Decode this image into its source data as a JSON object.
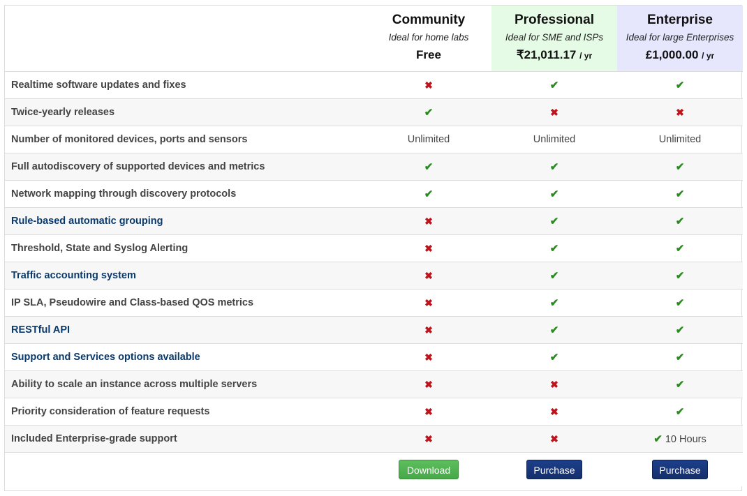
{
  "plans": [
    {
      "name": "Community",
      "description": "Ideal for home labs",
      "price": "Free",
      "unit": ""
    },
    {
      "name": "Professional",
      "description": "Ideal for SME and ISPs",
      "price": "₹21,011.17",
      "unit": "/ yr"
    },
    {
      "name": "Enterprise",
      "description": "Ideal for large Enterprises",
      "price": "£1,000.00",
      "unit": "/ yr"
    }
  ],
  "features": [
    {
      "label": "Realtime software updates and fixes",
      "link": false,
      "values": [
        "no",
        "yes",
        "yes"
      ]
    },
    {
      "label": "Twice-yearly releases",
      "link": false,
      "values": [
        "yes",
        "no",
        "no"
      ]
    },
    {
      "label": "Number of monitored devices, ports and sensors",
      "link": false,
      "values": [
        "Unlimited",
        "Unlimited",
        "Unlimited"
      ]
    },
    {
      "label": "Full autodiscovery of supported devices and metrics",
      "link": false,
      "values": [
        "yes",
        "yes",
        "yes"
      ]
    },
    {
      "label": "Network mapping through discovery protocols",
      "link": false,
      "values": [
        "yes",
        "yes",
        "yes"
      ]
    },
    {
      "label": "Rule-based automatic grouping",
      "link": true,
      "values": [
        "no",
        "yes",
        "yes"
      ]
    },
    {
      "label": "Threshold, State and Syslog Alerting",
      "link": false,
      "values": [
        "no",
        "yes",
        "yes"
      ]
    },
    {
      "label": "Traffic accounting system",
      "link": true,
      "values": [
        "no",
        "yes",
        "yes"
      ]
    },
    {
      "label": "IP SLA, Pseudowire and Class-based QOS metrics",
      "link": false,
      "values": [
        "no",
        "yes",
        "yes"
      ]
    },
    {
      "label": "RESTful API",
      "link": true,
      "values": [
        "no",
        "yes",
        "yes"
      ]
    },
    {
      "label": "Support and Services options available",
      "link": true,
      "values": [
        "no",
        "yes",
        "yes"
      ]
    },
    {
      "label": "Ability to scale an instance across multiple servers",
      "link": false,
      "values": [
        "no",
        "no",
        "yes"
      ]
    },
    {
      "label": "Priority consideration of feature requests",
      "link": false,
      "values": [
        "no",
        "no",
        "yes"
      ]
    },
    {
      "label": "Included Enterprise-grade support",
      "link": false,
      "values": [
        "no",
        "no",
        "yes:10 Hours"
      ]
    }
  ],
  "buttons": {
    "community": "Download",
    "professional": "Purchase",
    "enterprise": "Purchase"
  },
  "icons": {
    "yes": "check-icon",
    "no": "cross-icon"
  },
  "colors": {
    "check": "#2a8a1f",
    "cross": "#c0121a",
    "professional_bg": "#e5fbe5",
    "enterprise_bg": "#e6e6fd",
    "download_btn": "#4cae4c",
    "purchase_btn": "#1a3a80"
  }
}
